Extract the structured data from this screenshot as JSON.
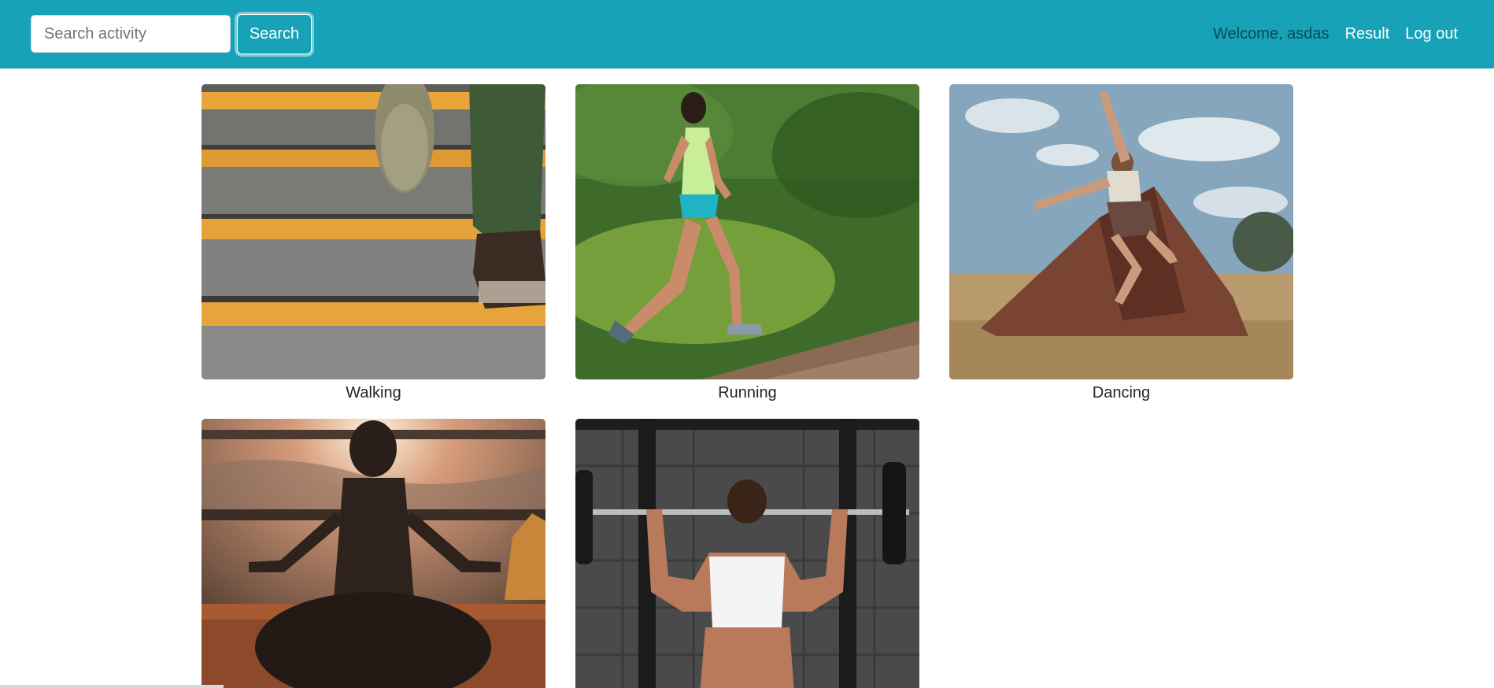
{
  "navbar": {
    "search_placeholder": "Search activity",
    "search_button": "Search",
    "welcome": "Welcome, asdas",
    "result_link": "Result",
    "logout_link": "Log out",
    "accent_color": "#17a2b8"
  },
  "activities": [
    {
      "title": "Walking",
      "image": "walking-stairs-photo"
    },
    {
      "title": "Running",
      "image": "woman-running-trail-photo"
    },
    {
      "title": "Dancing",
      "image": "dancer-jumping-tent-photo"
    },
    {
      "title": "",
      "image": "meditation-silhouette-photo"
    },
    {
      "title": "",
      "image": "woman-barbell-overhead-photo"
    }
  ]
}
